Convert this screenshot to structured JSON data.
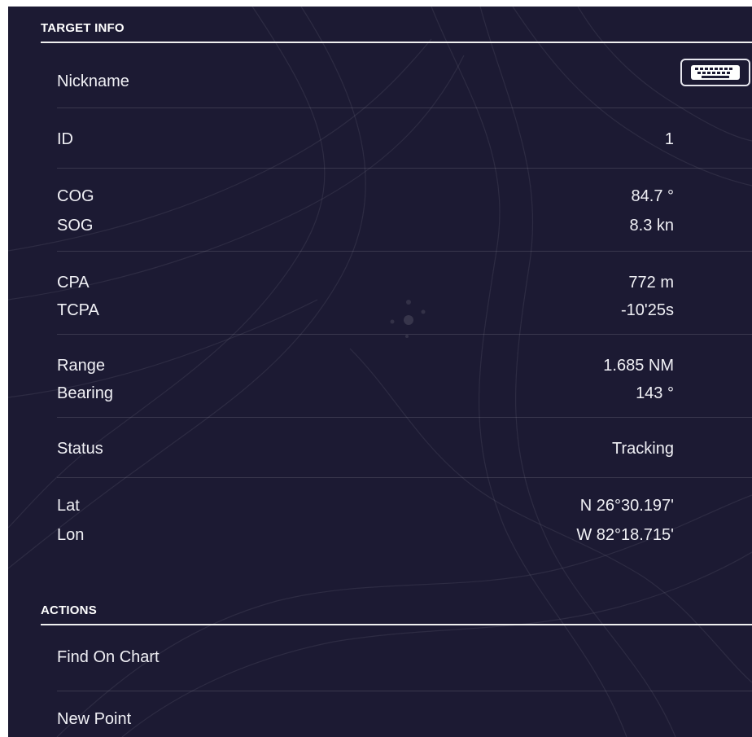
{
  "target_info": {
    "heading": "TARGET INFO",
    "nickname_label": "Nickname",
    "keyboard_icon": "keyboard-icon",
    "id": {
      "label": "ID",
      "value": "1"
    },
    "cog": {
      "label": "COG",
      "value": "84.7 °"
    },
    "sog": {
      "label": "SOG",
      "value": "8.3 kn"
    },
    "cpa": {
      "label": "CPA",
      "value": "772 m"
    },
    "tcpa": {
      "label": "TCPA",
      "value": "-10'25s"
    },
    "range": {
      "label": "Range",
      "value": "1.685 NM"
    },
    "bearing": {
      "label": "Bearing",
      "value": "143 °"
    },
    "status": {
      "label": "Status",
      "value": "Tracking"
    },
    "lat": {
      "label": "Lat",
      "value": "N 26°30.197'"
    },
    "lon": {
      "label": "Lon",
      "value": "W 82°18.715'"
    }
  },
  "actions": {
    "heading": "ACTIONS",
    "find_on_chart": "Find On Chart",
    "new_point": "New Point"
  },
  "colors": {
    "background": "#1c1a33",
    "text": "#f0f0f5",
    "divider": "#f0f0f0"
  }
}
